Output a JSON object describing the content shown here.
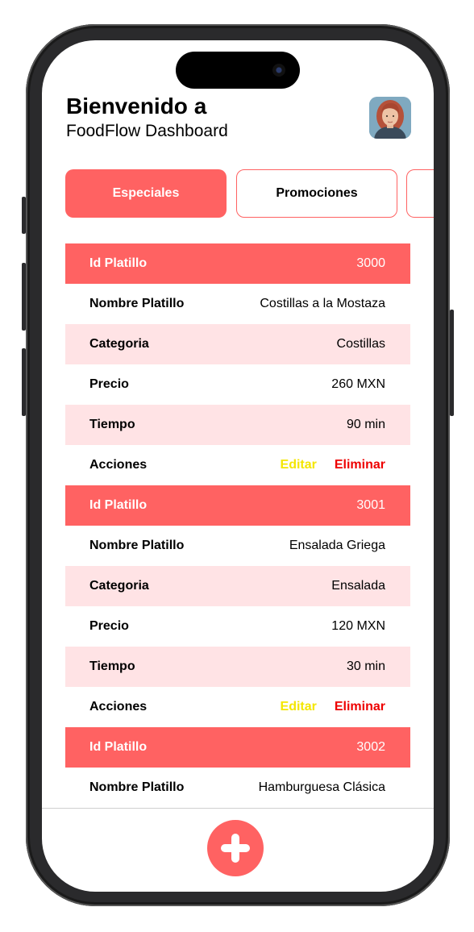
{
  "header": {
    "title": "Bienvenido a",
    "subtitle": "FoodFlow Dashboard",
    "avatar_icon": "user-avatar"
  },
  "tabs": [
    {
      "label": "Especiales",
      "active": true
    },
    {
      "label": "Promociones",
      "active": false
    },
    {
      "label": "",
      "active": false
    }
  ],
  "colors": {
    "accent": "#ff6262",
    "row_tint": "#ffe3e5",
    "edit": "#f4e600",
    "delete": "#ee0000"
  },
  "dishes": [
    {
      "id_label": "Id Platillo",
      "id": "3000",
      "name_label": "Nombre Platillo",
      "name": "Costillas a la Mostaza",
      "category_label": "Categoria",
      "category": "Costillas",
      "price_label": "Precio",
      "price": "260 MXN",
      "time_label": "Tiempo",
      "time": "90 min",
      "actions_label": "Acciones",
      "edit": "Editar",
      "delete": "Eliminar"
    },
    {
      "id_label": "Id Platillo",
      "id": "3001",
      "name_label": "Nombre Platillo",
      "name": "Ensalada Griega",
      "category_label": "Categoria",
      "category": "Ensalada",
      "price_label": "Precio",
      "price": "120 MXN",
      "time_label": "Tiempo",
      "time": "30 min",
      "actions_label": "Acciones",
      "edit": "Editar",
      "delete": "Eliminar"
    },
    {
      "id_label": "Id Platillo",
      "id": "3002",
      "name_label": "Nombre Platillo",
      "name": "Hamburguesa Clásica"
    }
  ],
  "fab_icon": "plus-icon"
}
